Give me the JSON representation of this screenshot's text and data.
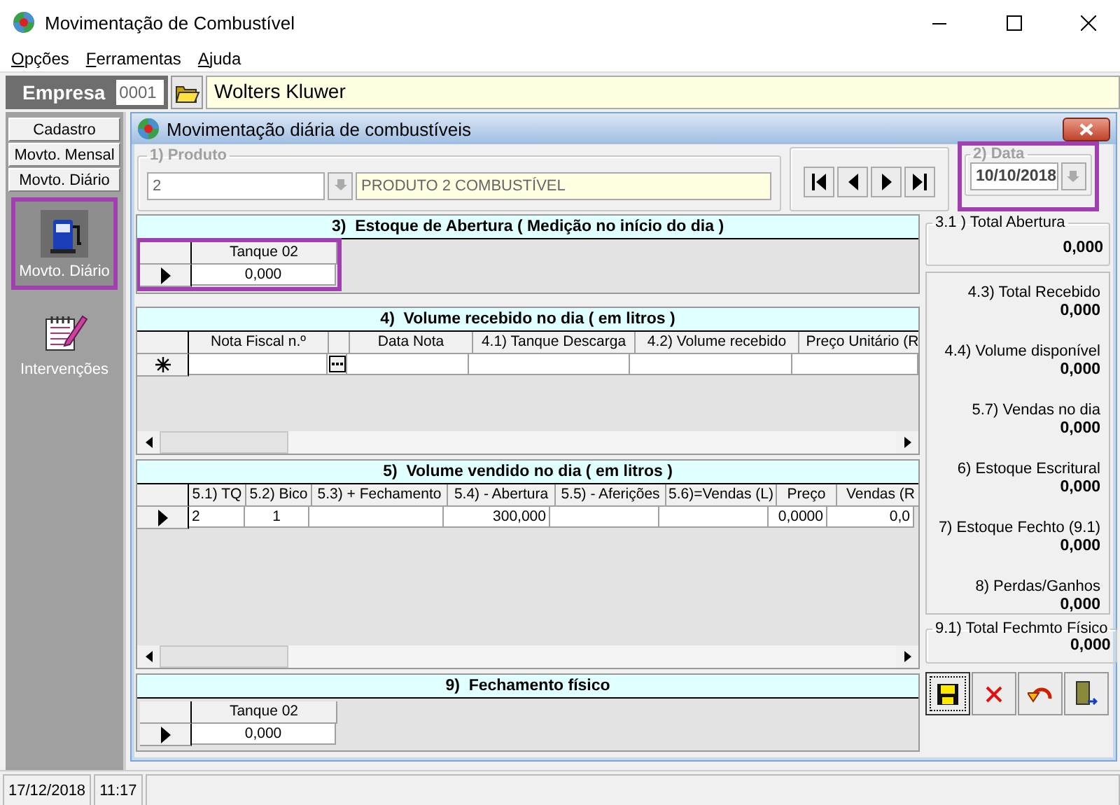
{
  "window": {
    "title": "Movimentação de Combustível"
  },
  "menu": [
    "Opções",
    "Ferramentas",
    "Ajuda"
  ],
  "company": {
    "label": "Empresa",
    "code": "0001",
    "name": "Wolters Kluwer"
  },
  "sidebar": {
    "tabs": [
      "Cadastro",
      "Movto. Mensal",
      "Movto. Diário"
    ],
    "items": [
      {
        "label": "Movto. Diário",
        "kind": "pump",
        "highlighted": true
      },
      {
        "label": "Intervenções",
        "kind": "notebook",
        "highlighted": false
      }
    ]
  },
  "form": {
    "title": "Movimentação diária de combustíveis",
    "product": {
      "legend": "1)  Produto",
      "code": "2",
      "name": "PRODUTO 2 COMBUSTÍVEL"
    },
    "date": {
      "legend": "2)  Data",
      "value": "10/10/2018",
      "highlighted": true
    },
    "opening_stock": {
      "title": "3)  Estoque de Abertura ( Medição no início do dia )",
      "highlighted": true,
      "columns": [
        {
          "label": "Tanque 02"
        }
      ],
      "rows": [
        {
          "kind": "current",
          "cells": [
            "0,000"
          ]
        }
      ]
    },
    "received": {
      "title": "4)  Volume recebido no dia ( em litros )",
      "columns": [
        {
          "kind": "text",
          "label": "Nota Fiscal n.º"
        },
        {
          "kind": "lookup"
        },
        {
          "kind": "text",
          "label": "Data Nota"
        },
        {
          "kind": "text",
          "label": "4.1) Tanque Descarga"
        },
        {
          "kind": "text",
          "label": "4.2) Volume recebido"
        },
        {
          "kind": "text",
          "label": "Preço Unitário (R"
        }
      ],
      "rows": [
        {
          "kind": "new",
          "cells": []
        }
      ]
    },
    "sold": {
      "title": "5)  Volume vendido no dia ( em litros )",
      "columns": [
        {
          "label": "5.1) TQ"
        },
        {
          "label": "5.2) Bico"
        },
        {
          "label": "5.3) + Fechamento"
        },
        {
          "label": "5.4) - Abertura"
        },
        {
          "label": "5.5) - Aferições"
        },
        {
          "label": "5.6)=Vendas (L)"
        },
        {
          "label": "Preço"
        },
        {
          "label": "Vendas (R"
        }
      ],
      "rows": [
        {
          "kind": "current",
          "cells": [
            "2",
            "1",
            null,
            "300,000",
            null,
            null,
            "0,0000",
            "0,0"
          ]
        }
      ]
    },
    "closing": {
      "title": "9)  Fechamento físico",
      "highlighted": false,
      "columns": [
        {
          "label": "Tanque 02"
        }
      ],
      "rows": [
        {
          "kind": "current",
          "cells": [
            "0,000"
          ]
        }
      ]
    },
    "totals": {
      "opening": {
        "legend": "3.1 )  Total Abertura",
        "value": "0,000"
      },
      "items": [
        {
          "label": "4.3) Total Recebido",
          "value": "0,000"
        },
        {
          "label": "4.4) Volume disponível",
          "value": "0,000"
        },
        {
          "label": "5.7) Vendas no dia",
          "value": "0,000"
        },
        {
          "label": "6) Estoque Escritural",
          "value": "0,000"
        },
        {
          "label": "7) Estoque Fechto (9.1)",
          "value": "0,000"
        },
        {
          "label": "8) Perdas/Ganhos",
          "value": "0,000"
        }
      ],
      "closing": {
        "legend": "9.1) Total Fechmto Físico",
        "value": "0,000"
      }
    }
  },
  "status_bar": {
    "date": "17/12/2018",
    "time": "11:17"
  }
}
